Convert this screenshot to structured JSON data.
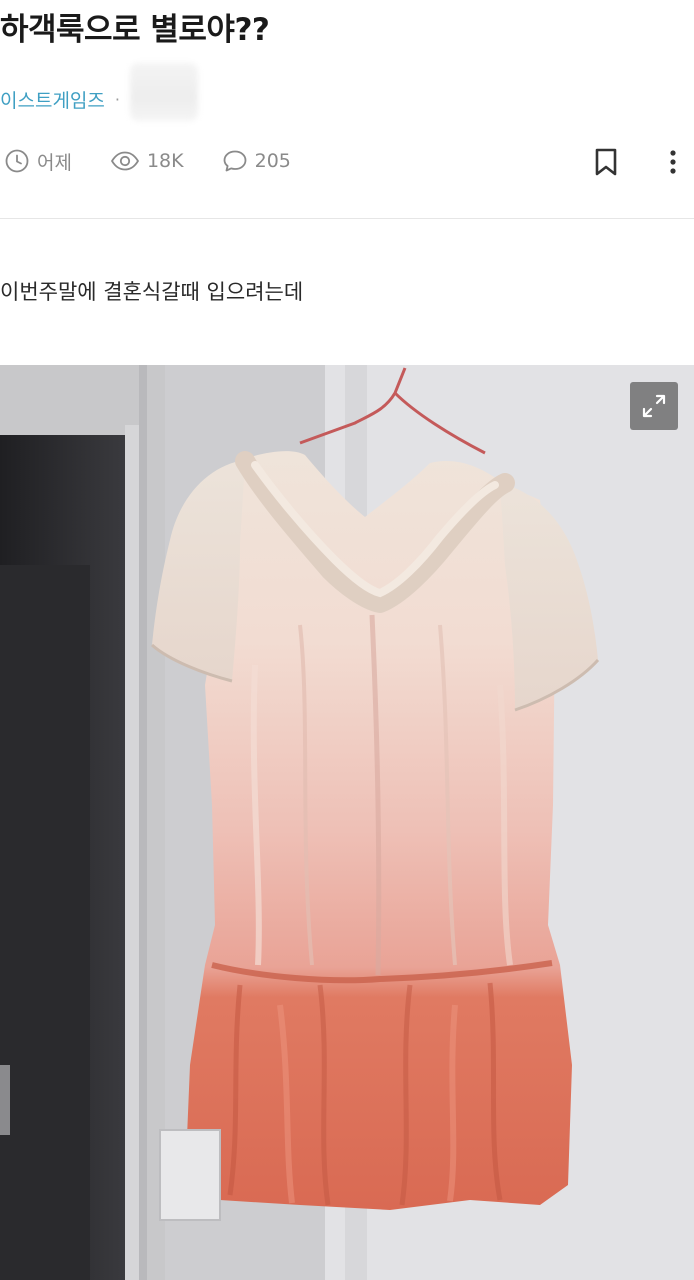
{
  "post": {
    "title": "하객룩으로 별로야??",
    "author": "이스트게임즈",
    "separator": "·",
    "body": "이번주말에 결혼식갈때 입으려는데"
  },
  "meta": {
    "time": "어제",
    "views": "18K",
    "comments": "205"
  },
  "icons": {
    "time": "clock-icon",
    "views": "eye-icon",
    "comments": "comment-bubble-icon",
    "bookmark": "bookmark-icon",
    "more": "more-vertical-icon",
    "expand": "expand-icon"
  },
  "colors": {
    "author": "#3f9fc3",
    "meta": "#8a8a8a",
    "divider": "#e6e6e6"
  }
}
